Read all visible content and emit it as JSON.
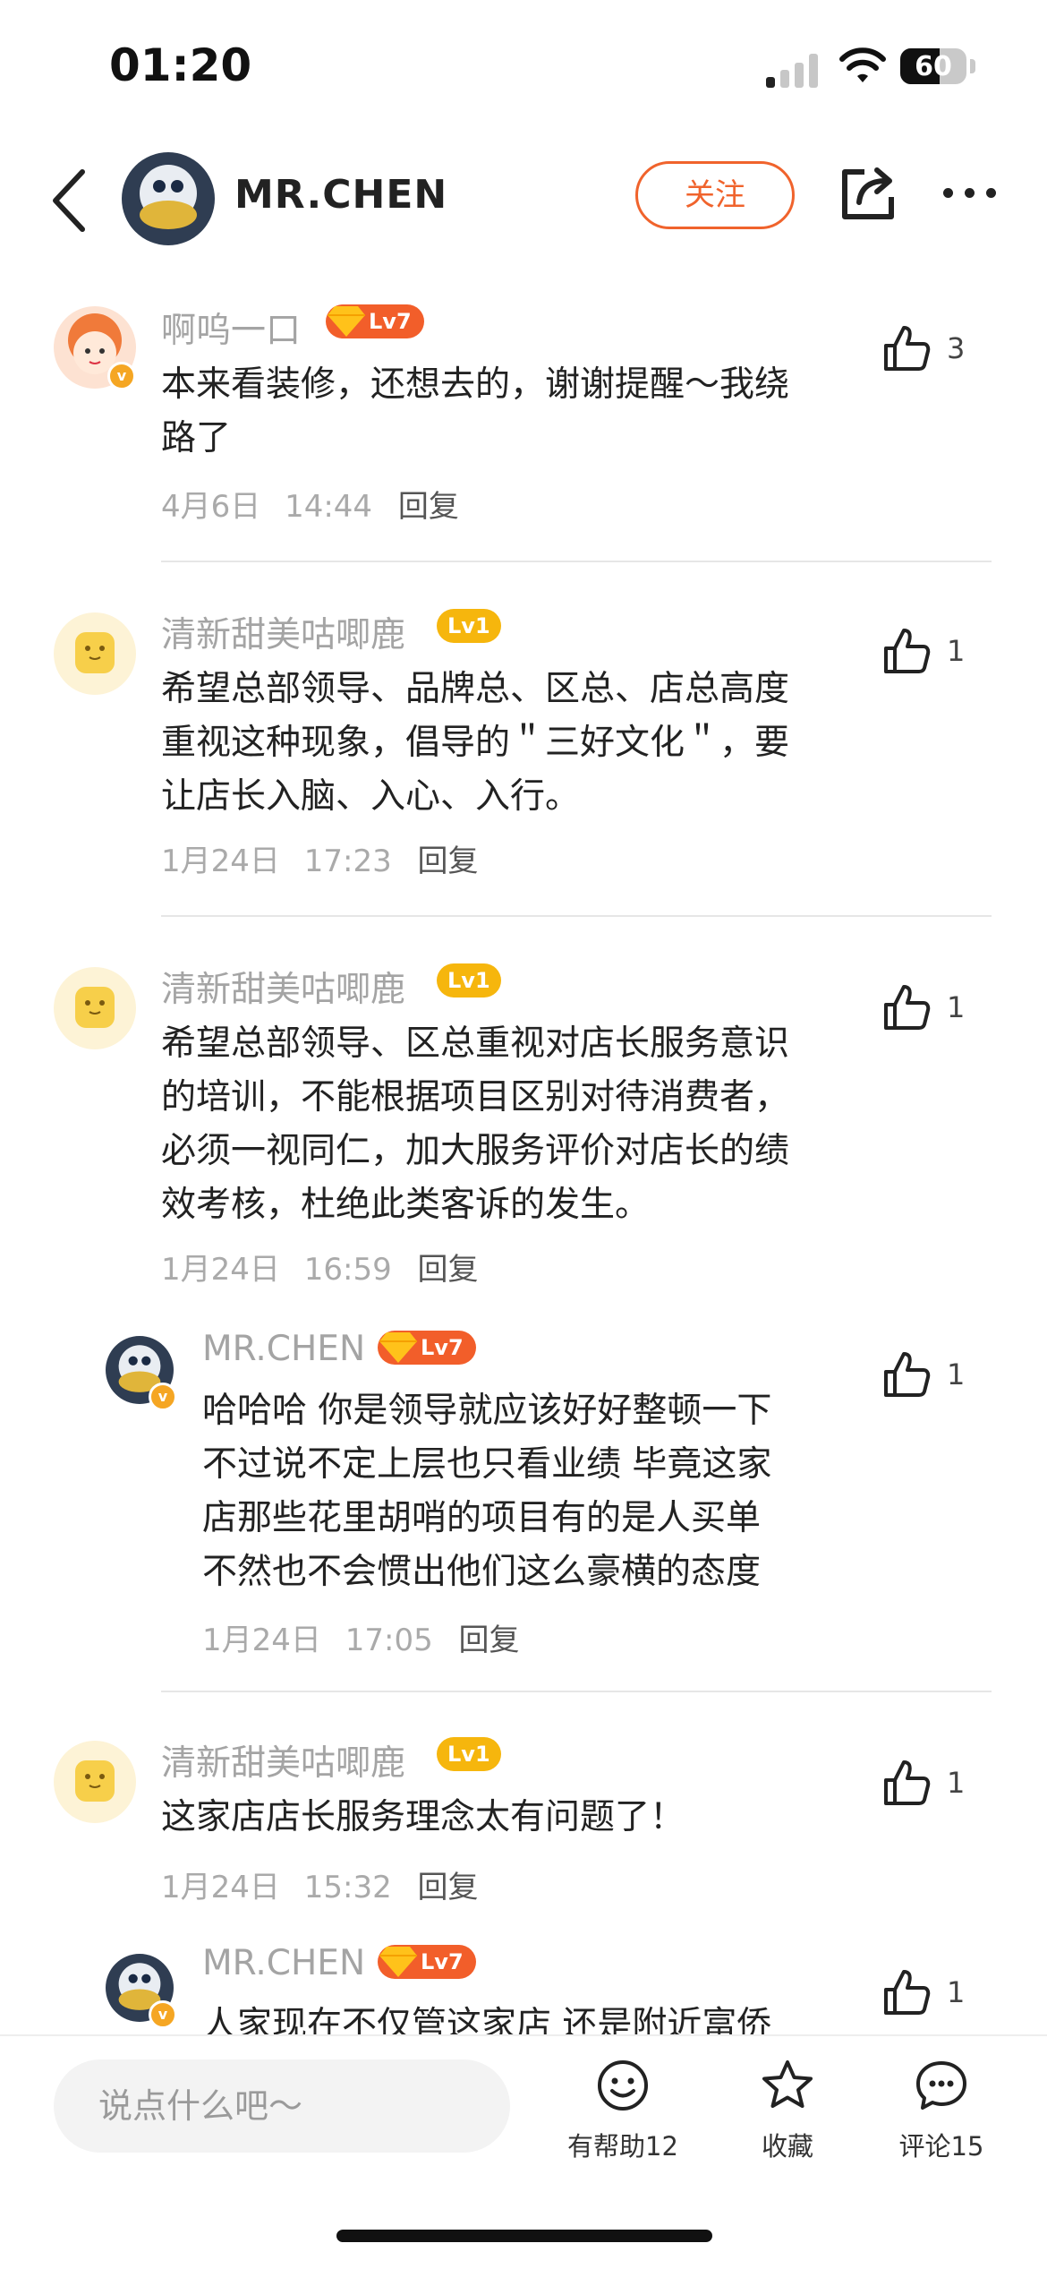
{
  "status_bar": {
    "time": "01:20",
    "battery": "60",
    "battery_level": 0.6
  },
  "header": {
    "name": "MR.CHEN",
    "follow_label": "关注"
  },
  "comments": [
    {
      "username": "啊呜一口",
      "level": "Lv7",
      "text_lines": [
        "本来看装修，还想去的，谢谢提醒～我绕",
        "路了"
      ],
      "date": "4月6日",
      "time": "14:44",
      "reply_label": "回复",
      "likes": "3"
    },
    {
      "username": "清新甜美咕唧鹿",
      "level": "Lv1",
      "text_lines": [
        "希望总部领导、品牌总、区总、店总高度",
        "重视这种现象，倡导的＂三好文化＂，要",
        "让店长入脑、入心、入行。"
      ],
      "date": "1月24日",
      "time": "17:23",
      "reply_label": "回复",
      "likes": "1"
    },
    {
      "username": "清新甜美咕唧鹿",
      "level": "Lv1",
      "text_lines": [
        "希望总部领导、区总重视对店长服务意识",
        "的培训，不能根据项目区别对待消费者，",
        "必须一视同仁，加大服务评价对店长的绩",
        "效考核，杜绝此类客诉的发生。"
      ],
      "date": "1月24日",
      "time": "16:59",
      "reply_label": "回复",
      "likes": "1"
    },
    {
      "username": "MR.CHEN",
      "level": "Lv7",
      "text_lines": [
        "哈哈哈 你是领导就应该好好整顿一下",
        "不过说不定上层也只看业绩 毕竟这家",
        "店那些花里胡哨的项目有的是人买单",
        "不然也不会惯出他们这么豪横的态度"
      ],
      "date": "1月24日",
      "time": "17:05",
      "reply_label": "回复",
      "likes": "1"
    },
    {
      "username": "清新甜美咕唧鹿",
      "level": "Lv1",
      "text_lines": [
        "这家店店长服务理念太有问题了！"
      ],
      "date": "1月24日",
      "time": "15:32",
      "reply_label": "回复",
      "likes": "1"
    },
    {
      "username": "MR.CHEN",
      "level": "Lv7",
      "text_lines": [
        "人家现在不仅管这家店 还是附近富侨"
      ],
      "likes": "1"
    }
  ],
  "bottom_bar": {
    "input_placeholder": "说点什么吧～",
    "helpful_label": "有帮助12",
    "collect_label": "收藏",
    "comment_label": "评论15"
  },
  "icons": [
    "back-icon",
    "share-icon",
    "more-icon",
    "like-icon",
    "smile-icon",
    "star-icon",
    "comment-icon",
    "gem-icon",
    "verified-badge-icon"
  ],
  "colors": {
    "accent": "#f0632c",
    "level_high": "#f25e2a",
    "level_low": "#f6b60d"
  }
}
